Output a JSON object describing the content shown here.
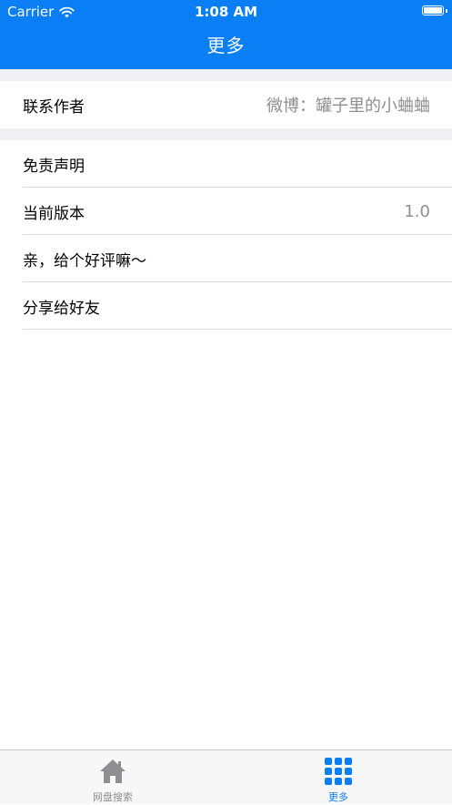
{
  "status_bar": {
    "carrier": "Carrier",
    "time": "1:08 AM"
  },
  "nav": {
    "title": "更多"
  },
  "sections": [
    {
      "cells": [
        {
          "label": "联系作者",
          "value": "微博：罐子里的小蛐蛐"
        }
      ]
    },
    {
      "cells": [
        {
          "label": "免责声明",
          "value": ""
        },
        {
          "label": "当前版本",
          "value": "1.0"
        },
        {
          "label": "亲，给个好评嘛～",
          "value": ""
        },
        {
          "label": "分享给好友",
          "value": ""
        }
      ]
    }
  ],
  "tabbar": {
    "tabs": [
      {
        "label": "网盘搜索",
        "icon": "home-icon",
        "active": false
      },
      {
        "label": "更多",
        "icon": "grid-icon",
        "active": true
      }
    ]
  },
  "colors": {
    "accent": "#0a7ff5",
    "inactive_tab": "#8e8e93",
    "group_background": "#efeff4",
    "secondary_text": "#8e8e93"
  }
}
